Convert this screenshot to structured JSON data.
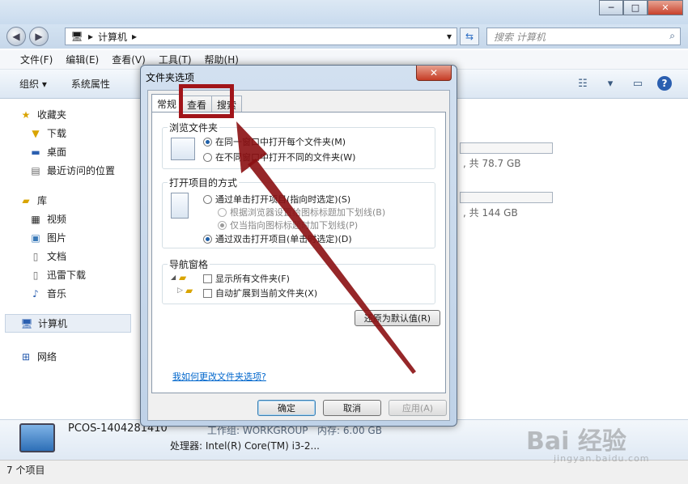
{
  "window": {
    "minimize": "─",
    "maximize": "□",
    "close": "✕"
  },
  "address": {
    "back": "◀",
    "forward": "▶",
    "path_label": "计算机",
    "search_placeholder": "搜索 计算机"
  },
  "menubar": {
    "items": [
      "文件(F)",
      "编辑(E)",
      "查看(V)",
      "工具(T)",
      "帮助(H)"
    ]
  },
  "toolbar": {
    "organize": "组织 ▾",
    "system_properties": "系统属性"
  },
  "sidebar": {
    "favorites_header": "收藏夹",
    "favorites": [
      "下载",
      "桌面",
      "最近访问的位置"
    ],
    "libraries_header": "库",
    "libraries": [
      "视频",
      "图片",
      "文档",
      "迅雷下载",
      "音乐"
    ],
    "computer": "计算机",
    "network": "网络"
  },
  "content": {
    "drive1_text": ", 共 78.7 GB",
    "drive2_text": ", 共 144 GB"
  },
  "details": {
    "computer_name": "PCOS-1404281410",
    "workgroup": "工作组: WORKGROUP",
    "memory": "内存: 6.00 GB",
    "processor": "处理器: Intel(R) Core(TM) i3-2..."
  },
  "status": {
    "item_count": "7 个项目"
  },
  "dialog": {
    "title": "文件夹选项",
    "close": "✕",
    "tabs": [
      "常规",
      "查看",
      "搜索"
    ],
    "browse_group": {
      "label": "浏览文件夹",
      "options": [
        "在同一窗口中打开每个文件夹(M)",
        "在不同窗口中打开不同的文件夹(W)"
      ]
    },
    "click_group": {
      "label": "打开项目的方式",
      "options": [
        "通过单击打开项目(指向时选定)(S)",
        "根据浏览器设置给图标标题加下划线(B)",
        "仅当指向图标标题时加下划线(P)",
        "通过双击打开项目(单击时选定)(D)"
      ]
    },
    "nav_group": {
      "label": "导航窗格",
      "options": [
        "显示所有文件夹(F)",
        "自动扩展到当前文件夹(X)"
      ]
    },
    "restore_button": "还原为默认值(R)",
    "help_link": "我如何更改文件夹选项?",
    "ok": "确定",
    "cancel": "取消",
    "apply": "应用(A)"
  },
  "watermark": {
    "brand": "Bai 经验",
    "url": "jingyan.baidu.com"
  },
  "colors": {
    "highlight": "#a11419",
    "arrow": "#8b0f12"
  }
}
